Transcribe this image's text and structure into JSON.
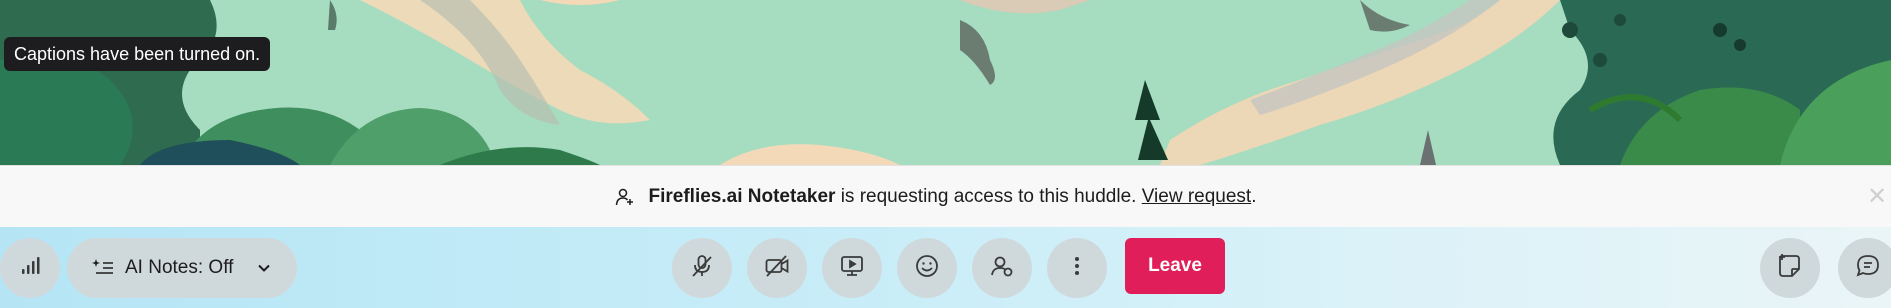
{
  "toast": {
    "text": "Captions have been turned on."
  },
  "banner": {
    "requester": "Fireflies.ai Notetaker",
    "message": " is requesting access to this huddle. ",
    "link_label": "View request",
    "period": "."
  },
  "controls": {
    "ai_notes_label": "AI Notes: Off",
    "leave_label": "Leave"
  },
  "colors": {
    "leave_button": "#e01e5a",
    "control_circle": "#cfd9dc",
    "toast_bg": "#1d1d1f"
  },
  "icons": [
    "signal-icon",
    "ai-notes-icon",
    "chevron-down-icon",
    "mic-off-icon",
    "video-off-icon",
    "screen-share-icon",
    "emoji-icon",
    "invite-people-icon",
    "more-icon",
    "add-note-icon",
    "chat-icon",
    "person-add-icon"
  ]
}
